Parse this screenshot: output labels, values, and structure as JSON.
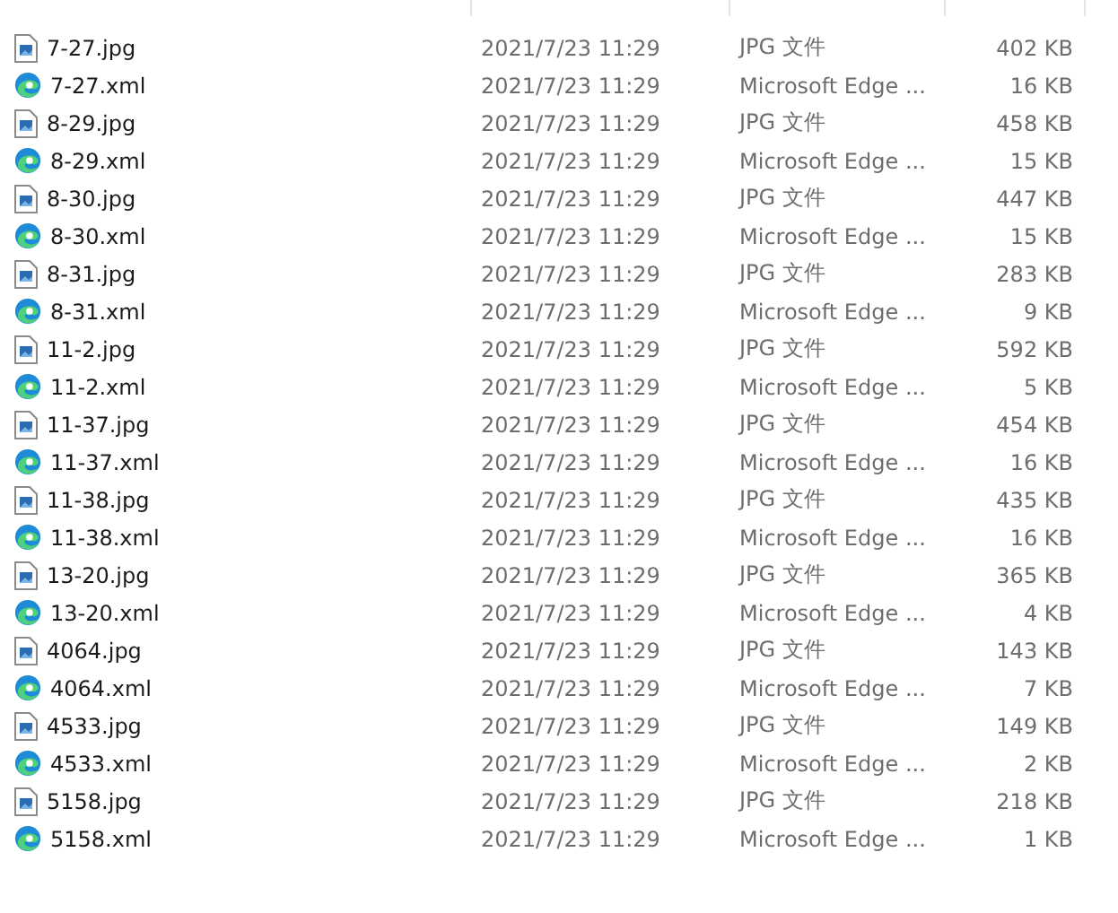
{
  "files": [
    {
      "name": "7-27.jpg",
      "kind": "image",
      "modified": "2021/7/23 11:29",
      "type": "JPG 文件",
      "size": "402 KB"
    },
    {
      "name": "7-27.xml",
      "kind": "edge",
      "modified": "2021/7/23 11:29",
      "type": "Microsoft Edge ...",
      "size": "16 KB"
    },
    {
      "name": "8-29.jpg",
      "kind": "image",
      "modified": "2021/7/23 11:29",
      "type": "JPG 文件",
      "size": "458 KB"
    },
    {
      "name": "8-29.xml",
      "kind": "edge",
      "modified": "2021/7/23 11:29",
      "type": "Microsoft Edge ...",
      "size": "15 KB"
    },
    {
      "name": "8-30.jpg",
      "kind": "image",
      "modified": "2021/7/23 11:29",
      "type": "JPG 文件",
      "size": "447 KB"
    },
    {
      "name": "8-30.xml",
      "kind": "edge",
      "modified": "2021/7/23 11:29",
      "type": "Microsoft Edge ...",
      "size": "15 KB"
    },
    {
      "name": "8-31.jpg",
      "kind": "image",
      "modified": "2021/7/23 11:29",
      "type": "JPG 文件",
      "size": "283 KB"
    },
    {
      "name": "8-31.xml",
      "kind": "edge",
      "modified": "2021/7/23 11:29",
      "type": "Microsoft Edge ...",
      "size": "9 KB"
    },
    {
      "name": "11-2.jpg",
      "kind": "image",
      "modified": "2021/7/23 11:29",
      "type": "JPG 文件",
      "size": "592 KB"
    },
    {
      "name": "11-2.xml",
      "kind": "edge",
      "modified": "2021/7/23 11:29",
      "type": "Microsoft Edge ...",
      "size": "5 KB"
    },
    {
      "name": "11-37.jpg",
      "kind": "image",
      "modified": "2021/7/23 11:29",
      "type": "JPG 文件",
      "size": "454 KB"
    },
    {
      "name": "11-37.xml",
      "kind": "edge",
      "modified": "2021/7/23 11:29",
      "type": "Microsoft Edge ...",
      "size": "16 KB"
    },
    {
      "name": "11-38.jpg",
      "kind": "image",
      "modified": "2021/7/23 11:29",
      "type": "JPG 文件",
      "size": "435 KB"
    },
    {
      "name": "11-38.xml",
      "kind": "edge",
      "modified": "2021/7/23 11:29",
      "type": "Microsoft Edge ...",
      "size": "16 KB"
    },
    {
      "name": "13-20.jpg",
      "kind": "image",
      "modified": "2021/7/23 11:29",
      "type": "JPG 文件",
      "size": "365 KB"
    },
    {
      "name": "13-20.xml",
      "kind": "edge",
      "modified": "2021/7/23 11:29",
      "type": "Microsoft Edge ...",
      "size": "4 KB"
    },
    {
      "name": "4064.jpg",
      "kind": "image",
      "modified": "2021/7/23 11:29",
      "type": "JPG 文件",
      "size": "143 KB"
    },
    {
      "name": "4064.xml",
      "kind": "edge",
      "modified": "2021/7/23 11:29",
      "type": "Microsoft Edge ...",
      "size": "7 KB"
    },
    {
      "name": "4533.jpg",
      "kind": "image",
      "modified": "2021/7/23 11:29",
      "type": "JPG 文件",
      "size": "149 KB"
    },
    {
      "name": "4533.xml",
      "kind": "edge",
      "modified": "2021/7/23 11:29",
      "type": "Microsoft Edge ...",
      "size": "2 KB"
    },
    {
      "name": "5158.jpg",
      "kind": "image",
      "modified": "2021/7/23 11:29",
      "type": "JPG 文件",
      "size": "218 KB"
    },
    {
      "name": "5158.xml",
      "kind": "edge",
      "modified": "2021/7/23 11:29",
      "type": "Microsoft Edge ...",
      "size": "1 KB"
    }
  ]
}
